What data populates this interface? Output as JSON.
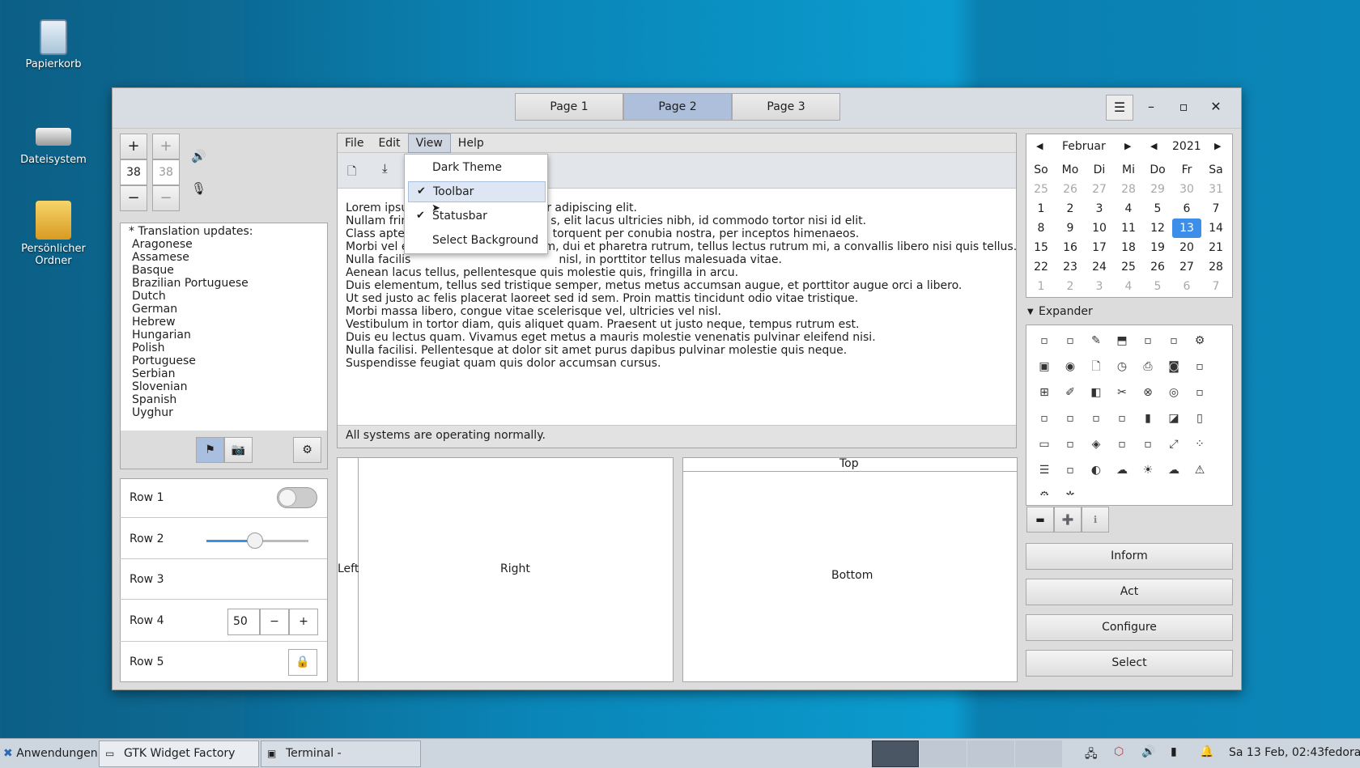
{
  "desktop": {
    "icons": [
      {
        "label": "Papierkorb"
      },
      {
        "label": "Dateisystem"
      },
      {
        "label": "Persönlicher Ordner"
      }
    ]
  },
  "window": {
    "tabs": [
      "Page 1",
      "Page 2",
      "Page 3"
    ],
    "active_tab": "Page 2"
  },
  "spin": {
    "a": "38",
    "b": "38"
  },
  "languages": {
    "header": "* Translation updates:",
    "items": [
      "Aragonese",
      "Assamese",
      "Basque",
      "Brazilian Portuguese",
      "Dutch",
      "German",
      "Hebrew",
      "Hungarian",
      "Polish",
      "Portuguese",
      "Serbian",
      "Slovenian",
      "Spanish",
      "Uyghur"
    ]
  },
  "rows": {
    "r1": "Row 1",
    "r2": "Row 2",
    "r3": "Row 3",
    "r4": "Row 4",
    "r5": "Row 5",
    "r4_value": "50",
    "slider_percent": 48
  },
  "menubar": {
    "file": "File",
    "edit": "Edit",
    "view": "View",
    "help": "Help"
  },
  "view_menu": {
    "items": [
      {
        "label": "Dark Theme",
        "checked": false
      },
      {
        "label": "Toolbar",
        "checked": true
      },
      {
        "label": "Statusbar",
        "checked": true
      },
      {
        "label": "Select Background",
        "checked": false
      }
    ]
  },
  "text": {
    "l1": "Lorem ipsu",
    "l1b": "etur adipiscing elit.",
    "l2": "Nullam frin",
    "l2b": "s, elit lacus ultricies nibh, id commodo tortor nisi id elit.",
    "l3": "Class apter",
    "l3b": "torquent per conubia nostra, per inceptos himenaeos.",
    "l4": "Morbi vel e",
    "l4b": "m, dui et pharetra rutrum, tellus lectus rutrum mi, a convallis libero nisi quis tellus.",
    "l5": "Nulla facilis",
    "l5b": "nisl, in porttitor tellus malesuada vitae.",
    "l6": "Aenean lacus tellus, pellentesque quis molestie quis, fringilla in arcu.",
    "l7": "Duis elementum, tellus sed tristique semper, metus metus accumsan augue, et porttitor augue orci a libero.",
    "l8": "Ut sed justo ac felis placerat laoreet sed id sem. Proin mattis tincidunt odio vitae tristique.",
    "l9": "Morbi massa libero, congue vitae scelerisque vel, ultricies vel nisl.",
    "l10": "Vestibulum in tortor diam, quis aliquet quam. Praesent ut justo neque, tempus rutrum est.",
    "l11": "Duis eu lectus quam. Vivamus eget metus a mauris molestie venenatis pulvinar eleifend nisi.",
    "l12": "Nulla facilisi. Pellentesque at dolor sit amet purus dapibus pulvinar molestie quis neque.",
    "l13": "Suspendisse feugiat quam quis dolor accumsan cursus."
  },
  "status": "All systems are operating normally.",
  "panes": {
    "left": "Left",
    "right": "Right",
    "top": "Top",
    "bottom": "Bottom"
  },
  "calendar": {
    "month": "Februar",
    "year": "2021",
    "weekdays": [
      "So",
      "Mo",
      "Di",
      "Mi",
      "Do",
      "Fr",
      "Sa"
    ],
    "weeks": [
      [
        "25",
        "26",
        "27",
        "28",
        "29",
        "30",
        "31"
      ],
      [
        "1",
        "2",
        "3",
        "4",
        "5",
        "6",
        "7"
      ],
      [
        "8",
        "9",
        "10",
        "11",
        "12",
        "13",
        "14"
      ],
      [
        "15",
        "16",
        "17",
        "18",
        "19",
        "20",
        "21"
      ],
      [
        "22",
        "23",
        "24",
        "25",
        "26",
        "27",
        "28"
      ],
      [
        "1",
        "2",
        "3",
        "4",
        "5",
        "6",
        "7"
      ]
    ],
    "selected": "13"
  },
  "expander": {
    "label": "Expander"
  },
  "actions": {
    "inform": "Inform",
    "act": "Act",
    "configure": "Configure",
    "select": "Select"
  },
  "taskbar": {
    "apps": "Anwendungen",
    "task1": "GTK Widget Factory",
    "task2": "Terminal - fedora@fedo...",
    "clock": "Sa 13 Feb, 02:43",
    "user": "fedora"
  }
}
